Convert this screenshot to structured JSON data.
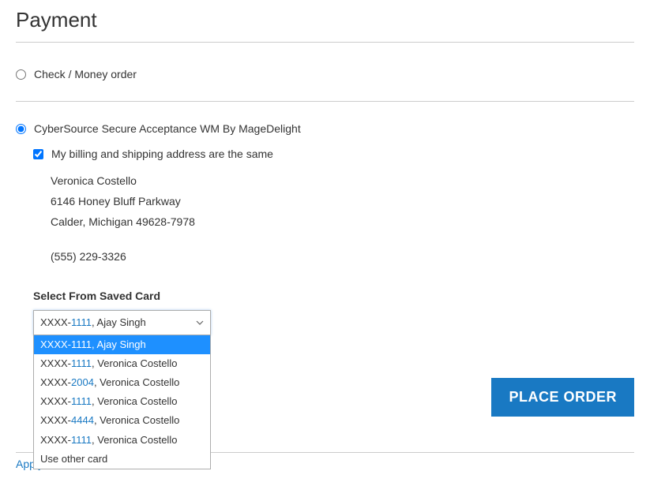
{
  "title": "Payment",
  "methods": {
    "check": {
      "label": "Check / Money order",
      "selected": false
    },
    "cybersource": {
      "label": "CyberSource Secure Acceptance WM By MageDelight",
      "selected": true
    }
  },
  "billing": {
    "sameAddressLabel": "My billing and shipping address are the same",
    "sameAddressChecked": true,
    "address": {
      "name": "Veronica Costello",
      "street": "6146 Honey Bluff Parkway",
      "cityRegionPostal": "Calder, Michigan 49628-7978",
      "phone": "(555) 229-3326"
    }
  },
  "savedCard": {
    "label": "Select From Saved Card",
    "selectedMasked": "XXXX-",
    "selectedDigits": "1111",
    "selectedHolder": ", Ajay Singh",
    "options": [
      {
        "masked": "XXXX-",
        "digits": "1111",
        "holder": ", Ajay Singh"
      },
      {
        "masked": "XXXX-",
        "digits": "1111",
        "holder": ", Veronica Costello"
      },
      {
        "masked": "XXXX-",
        "digits": "2004",
        "holder": ", Veronica Costello"
      },
      {
        "masked": "XXXX-",
        "digits": "1111",
        "holder": ", Veronica Costello"
      },
      {
        "masked": "XXXX-",
        "digits": "4444",
        "holder": ", Veronica Costello"
      },
      {
        "masked": "XXXX-",
        "digits": "1111",
        "holder": ", Veronica Costello"
      },
      {
        "masked": "",
        "digits": "",
        "holder": "Use other card"
      }
    ]
  },
  "actions": {
    "placeOrder": "PLACE ORDER"
  },
  "discount": {
    "label": "Apply Discount Code"
  }
}
